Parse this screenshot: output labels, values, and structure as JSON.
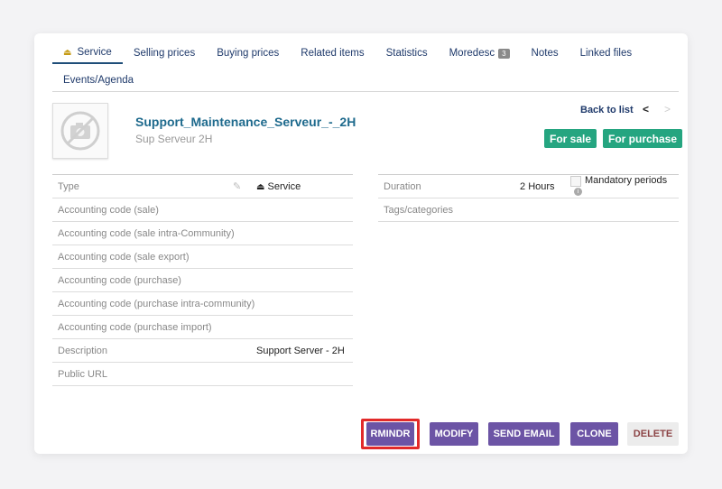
{
  "tabs": [
    {
      "label": "Service"
    },
    {
      "label": "Selling prices"
    },
    {
      "label": "Buying prices"
    },
    {
      "label": "Related items"
    },
    {
      "label": "Statistics"
    },
    {
      "label": "Moredesc",
      "badge": "3"
    },
    {
      "label": "Notes"
    },
    {
      "label": "Linked files"
    }
  ],
  "tabs2": [
    {
      "label": "Events/Agenda"
    }
  ],
  "header": {
    "ref": "Support_Maintenance_Serveur_-_2H",
    "label": "Sup Serveur 2H",
    "back": "Back to list",
    "prev": "<",
    "next": ">",
    "status_sale": "For sale",
    "status_purchase": "For purchase"
  },
  "left_fields": [
    {
      "label": "Type",
      "value": "Service"
    },
    {
      "label": "Accounting code (sale)",
      "value": ""
    },
    {
      "label": "Accounting code (sale intra-Community)",
      "value": ""
    },
    {
      "label": "Accounting code (sale export)",
      "value": ""
    },
    {
      "label": "Accounting code (purchase)",
      "value": ""
    },
    {
      "label": "Accounting code (purchase intra-community)",
      "value": ""
    },
    {
      "label": "Accounting code (purchase import)",
      "value": ""
    },
    {
      "label": "Description",
      "value": "Support Server - 2H"
    },
    {
      "label": "Public URL",
      "value": ""
    }
  ],
  "right_fields": {
    "duration_label": "Duration",
    "duration_value": "2",
    "duration_unit": "Hours",
    "mandatory_label": "Mandatory periods",
    "tags_label": "Tags/categories"
  },
  "buttons": {
    "rmindr": "RMINDR",
    "modify": "MODIFY",
    "send_email": "SEND EMAIL",
    "clone": "CLONE",
    "delete": "DELETE"
  },
  "colors": {
    "accent": "#6c54a5",
    "status_green": "#25a580",
    "link_blue": "#1e6a8d",
    "highlight_red": "#e22a2a"
  }
}
